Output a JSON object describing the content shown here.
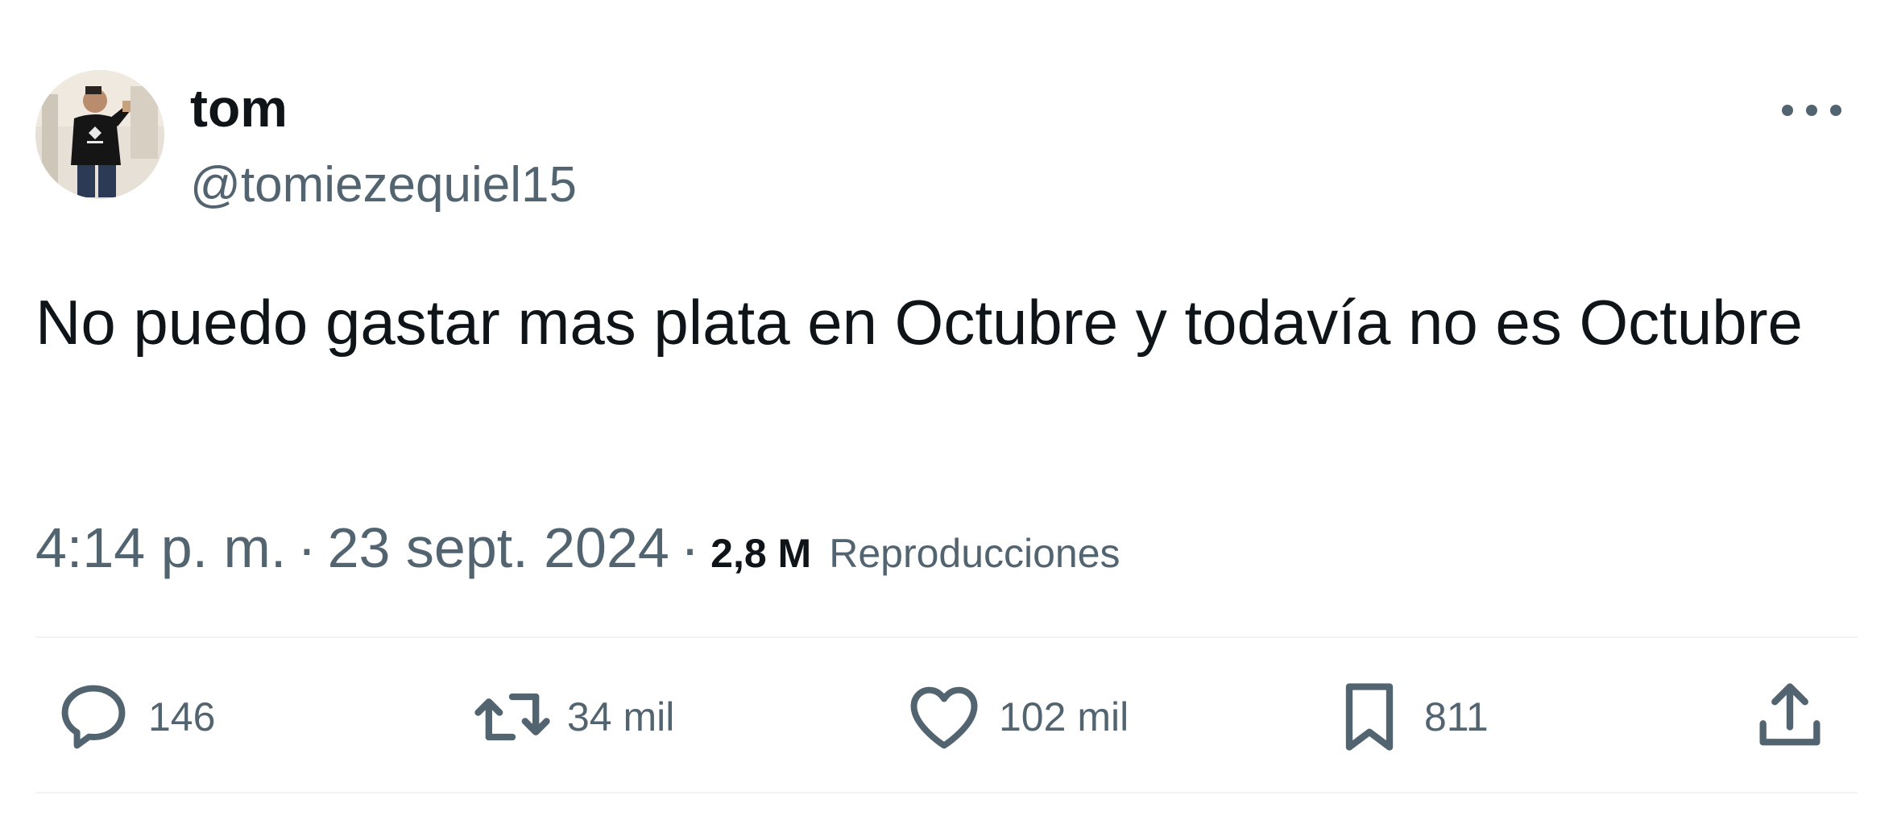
{
  "author": {
    "display_name": "tom",
    "handle": "@tomiezequiel15"
  },
  "tweet": {
    "text": "No puedo gastar mas plata en Octubre y todavía no es Octubre",
    "time": "4:14 p. m.",
    "date": "23 sept. 2024",
    "separator": "·",
    "views_count": "2,8 M",
    "views_label": "Reproducciones"
  },
  "actions": {
    "replies": "146",
    "retweets": "34 mil",
    "likes": "102 mil",
    "bookmarks": "811"
  },
  "icons": {
    "more": "more-horizontal-icon",
    "reply": "reply-bubble-icon",
    "retweet": "retweet-icon",
    "like": "heart-icon",
    "bookmark": "bookmark-icon",
    "share": "share-upload-icon"
  },
  "colors": {
    "text_primary": "#0f1419",
    "text_secondary": "#536471",
    "divider": "#eff3f4",
    "background": "#ffffff"
  }
}
